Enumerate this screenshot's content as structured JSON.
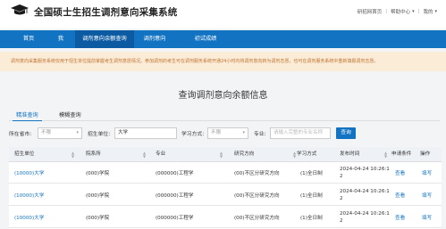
{
  "header": {
    "site_title": "全国硕士生招生调剂意向采集系统",
    "links": [
      "研招网首页",
      "帮助中心",
      "我的"
    ]
  },
  "nav": {
    "items": [
      "首页",
      "我",
      "调剂意向余额查询",
      "调剂意向",
      "初试成绩"
    ],
    "active_index": 2
  },
  "notice": {
    "text": "调剂意向采集服务系统仅用于招生单位提前掌握考生调剂意愿情况。参加调剂的考生可在调剂服务系统开通24小时内将调剂意向转为调剂志愿，也可在调剂服务系统中重新填报调剂志愿。"
  },
  "page": {
    "title": "查询调剂意向余额信息"
  },
  "tabs": {
    "items": [
      "精准查询",
      "模糊查询"
    ],
    "active_index": 0
  },
  "filters": {
    "province_label": "所在省市:",
    "province_value": "不限",
    "unit_label": "招生单位:",
    "unit_value": "大学",
    "mode_label": "学习方式:",
    "mode_value": "不限",
    "major_label": "专业:",
    "major_placeholder": "请输入完整的专业名称",
    "search_label": "查询"
  },
  "table": {
    "columns": [
      "招生单位",
      "院系所",
      "专业",
      "研究方向",
      "学习方式",
      "发布时间",
      "申请条件",
      "操作"
    ],
    "rows": [
      {
        "unit": "(10000)大学",
        "dept": "(000)学院",
        "major": "(000000)工程学",
        "direction": "(00)不区分研究方向",
        "mode": "(1)全日制",
        "time_line1": "2024-04-24 10:26:1",
        "time_line2": "2",
        "cond": "查看",
        "action": "填写"
      },
      {
        "unit": "(10000)大学",
        "dept": "(000)学院",
        "major": "(000000)工程学",
        "direction": "(00)不区分研究方向",
        "mode": "(1)全日制",
        "time_line1": "2024-04-24 10:26:1",
        "time_line2": "2",
        "cond": "查看",
        "action": "填写"
      },
      {
        "unit": "(10000)大学",
        "dept": "(000)学院",
        "major": "(000000)工程学",
        "direction": "(00)不区分研究方向",
        "mode": "(1)全日制",
        "time_line1": "2024-04-24 10:26:1",
        "time_line2": "2",
        "cond": "查看",
        "action": "填写"
      }
    ]
  },
  "colors": {
    "primary": "#1273c2",
    "primary_dark": "#0b5aa2",
    "notice_bg": "#fbecd8",
    "notice_text": "#c0722f"
  },
  "icons": {
    "logo": "graduation-cap-icon",
    "dropdown": "caret-down-icon",
    "sort": "sort-arrows-icon"
  }
}
